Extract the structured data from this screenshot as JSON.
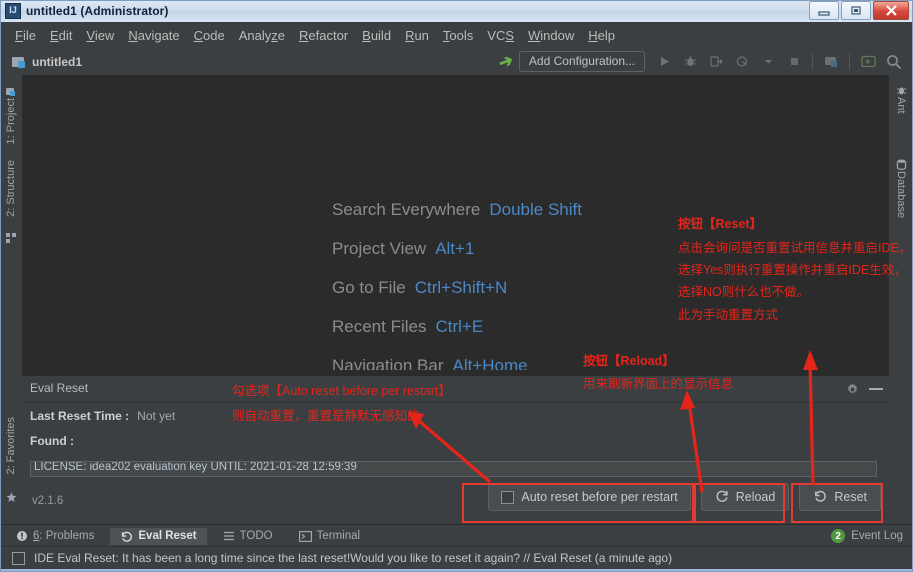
{
  "window": {
    "title": "untitled1 (Administrator)",
    "icon": "idea-logo-icon",
    "controls": {
      "minimize": "minimize",
      "maximize": "maximize",
      "close": "close"
    }
  },
  "menubar": {
    "items": [
      {
        "label": "File",
        "mnemonic": "F"
      },
      {
        "label": "Edit",
        "mnemonic": "E"
      },
      {
        "label": "View",
        "mnemonic": "V"
      },
      {
        "label": "Navigate",
        "mnemonic": "N"
      },
      {
        "label": "Code",
        "mnemonic": "C"
      },
      {
        "label": "Analyze",
        "mnemonic": "z"
      },
      {
        "label": "Refactor",
        "mnemonic": "R"
      },
      {
        "label": "Build",
        "mnemonic": "B"
      },
      {
        "label": "Run",
        "mnemonic": "R"
      },
      {
        "label": "Tools",
        "mnemonic": "T"
      },
      {
        "label": "VCS",
        "mnemonic": "S"
      },
      {
        "label": "Window",
        "mnemonic": "W"
      },
      {
        "label": "Help",
        "mnemonic": "H"
      }
    ]
  },
  "navbar": {
    "project_name": "untitled1",
    "add_configuration": "Add Configuration...",
    "icons": [
      "build-icon",
      "run-icon",
      "debug-icon",
      "run-coverage-icon",
      "profile-icon",
      "dropdown-icon",
      "stop-icon",
      "project-structure-icon",
      "updates-icon",
      "search-icon"
    ]
  },
  "left_strip": {
    "items": [
      {
        "label": "1: Project",
        "mnemonic": "1"
      },
      {
        "label": "2: Structure",
        "mnemonic": "2"
      },
      {
        "label": "2: Favorites",
        "mnemonic": "2"
      }
    ]
  },
  "right_strip": {
    "items": [
      {
        "label": "Ant"
      },
      {
        "label": "Database"
      }
    ]
  },
  "editor": {
    "hints": [
      {
        "action": "Search Everywhere",
        "shortcut": "Double Shift"
      },
      {
        "action": "Project View",
        "shortcut": "Alt+1"
      },
      {
        "action": "Go to File",
        "shortcut": "Ctrl+Shift+N"
      },
      {
        "action": "Recent Files",
        "shortcut": "Ctrl+E"
      },
      {
        "action": "Navigation Bar",
        "shortcut": "Alt+Home"
      }
    ]
  },
  "eval_reset_panel": {
    "title": "Eval Reset",
    "last_reset_label": "Last Reset Time :",
    "last_reset_value": "Not yet",
    "found_label": "Found :",
    "license_text": "LICENSE: idea202 evaluation key  UNTIL: 2021-01-28 12:59:39",
    "version": "v2.1.6",
    "auto_reset_label": "Auto reset before per restart",
    "auto_reset_checked": false,
    "reload_label": "Reload",
    "reset_label": "Reset",
    "header_icons": [
      "gear-icon",
      "minimize-icon"
    ]
  },
  "annotations": {
    "reset": {
      "line1": "按钮【Reset】",
      "line2": "点击会询问是否重置试用信息并重启IDE，",
      "line3": "选择Yes则执行重置操作并重启IDE生效，",
      "line4": "选择NO则什么也不做。",
      "line5": "此为手动重置方式"
    },
    "reload": {
      "line1": "按钮【Reload】",
      "line2": "用来刷新界面上的显示信息"
    },
    "auto_reset": {
      "line1": "勾选项【Auto reset before per restart】",
      "line2": "则自动重置，重置是静默无感知的"
    },
    "color": "#e5241a"
  },
  "bottom_tabs": {
    "items": [
      {
        "label": "6: Problems",
        "mnemonic": "6",
        "icon": "problems-icon",
        "active": false
      },
      {
        "label": "Eval Reset",
        "icon": "reset-icon",
        "active": true
      },
      {
        "label": "TODO",
        "icon": "todo-icon",
        "active": false
      },
      {
        "label": "Terminal",
        "icon": "terminal-icon",
        "active": false
      }
    ],
    "event_log": {
      "label": "Event Log",
      "count": "2"
    }
  },
  "status_bar": {
    "message": "IDE Eval Reset: It has been a long time since the last reset!Would you like to reset it again? // Eval Reset (a minute ago)",
    "icon": "notification-icon"
  }
}
